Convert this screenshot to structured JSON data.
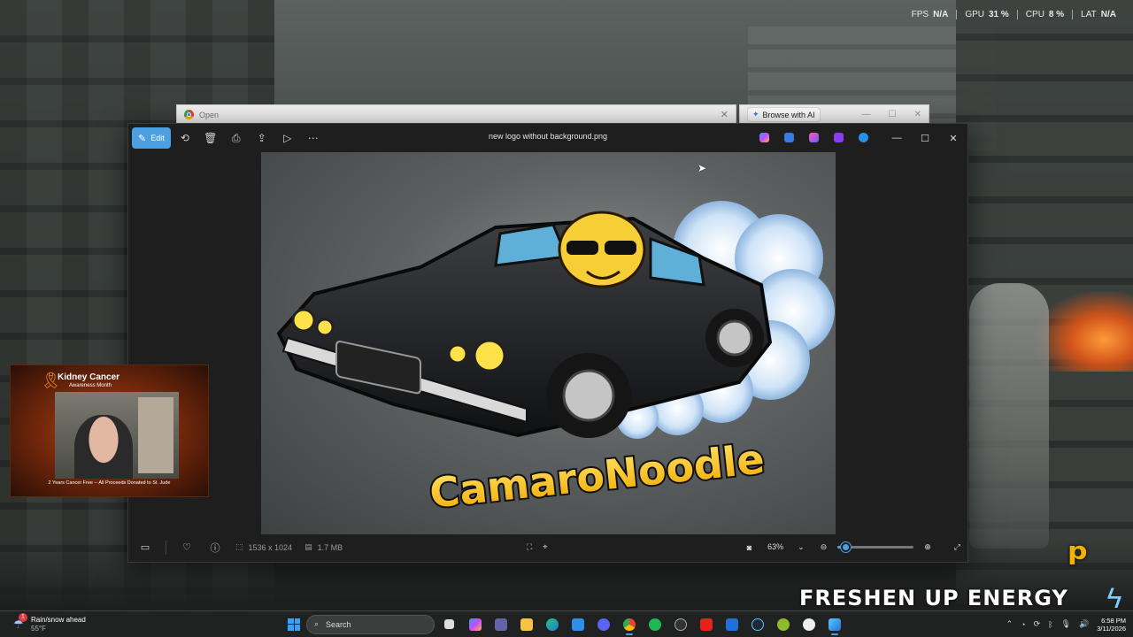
{
  "hud": {
    "fps_label": "FPS",
    "fps_value": "N/A",
    "gpu_label": "GPU",
    "gpu_value": "31 %",
    "cpu_label": "CPU",
    "cpu_value": "8 %",
    "lat_label": "LAT",
    "lat_value": "N/A"
  },
  "background_windows": {
    "browser_tab_title": "Open",
    "browse_ai_label": "Browse with AI"
  },
  "photos": {
    "edit_label": "Edit",
    "filename": "new logo without background.png",
    "image_logo_text": "CamaroNoodle",
    "dimensions": "1536 x 1024",
    "file_size": "1.7 MB",
    "zoom_value": "63%",
    "zoom_slider_fraction": 0.1
  },
  "webcam": {
    "title": "Kidney Cancer",
    "subtitle": "Awareness Month",
    "caption": "2 Years Cancer Free -- All Proceeds Donated to St. Jude"
  },
  "brand": {
    "text": "FRESHEN UP ENERGY"
  },
  "taskbar": {
    "weather_badge": "1",
    "weather_title": "Rain/snow ahead",
    "weather_temp": "55°F",
    "search_placeholder": "Search",
    "time": "6:58 PM",
    "date": "3/11/2026"
  },
  "colors": {
    "accent": "#4ba0e4",
    "logo_yellow": "#f5c518"
  }
}
